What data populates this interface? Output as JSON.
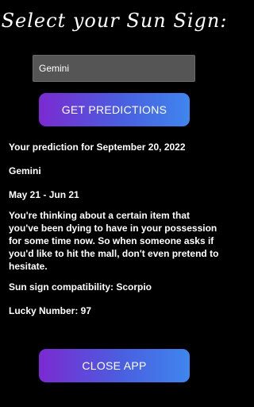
{
  "header": {
    "title": "Select your Sun Sign:"
  },
  "sign_input": {
    "value": "Gemini"
  },
  "buttons": {
    "get_predictions": "GET PREDICTIONS",
    "close_app": "CLOSE APP"
  },
  "result": {
    "prediction_heading": "Your prediction for September 20, 2022",
    "sign_name": "Gemini",
    "date_range": "May 21 - Jun 21",
    "prediction_text": "You're thinking about a certain item that you've been dying to have in your possession for some time now. So when someone asks if you'd like to hit the mall, don't even pretend to hesitate.",
    "compatibility": "Sun sign compatibility:  Scorpio",
    "lucky_number": "Lucky Number:  97"
  },
  "colors": {
    "background": "#000000",
    "button_gradient_start": "#7b2ad1",
    "button_gradient_end": "#3f86ee",
    "input_background": "#555555"
  }
}
